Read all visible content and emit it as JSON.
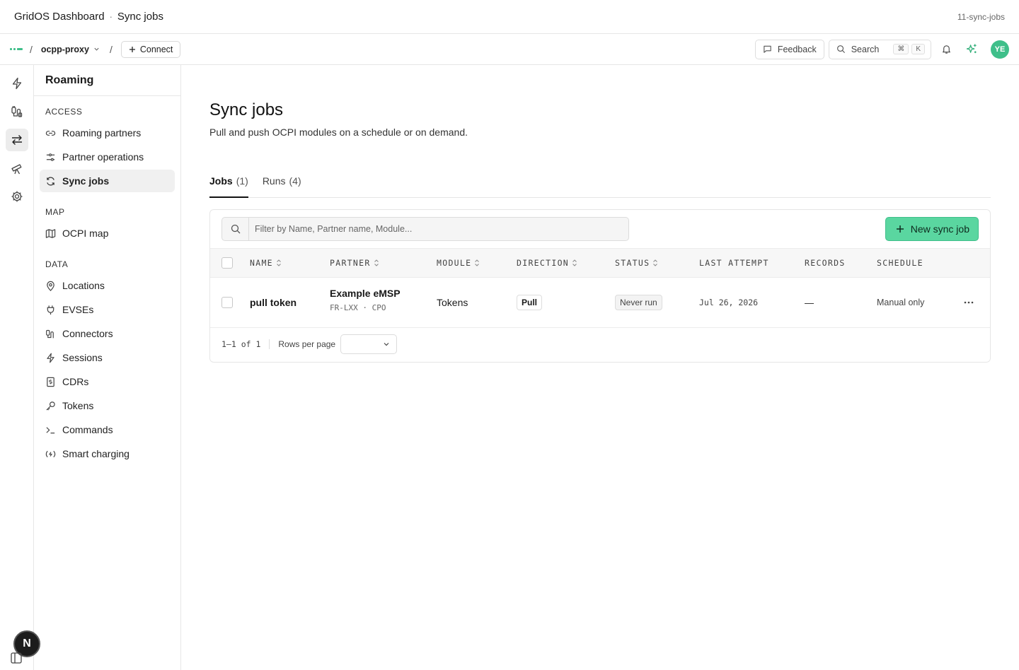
{
  "window": {
    "app_title": "GridOS Dashboard",
    "separator": "·",
    "page": "Sync jobs",
    "tag": "11-sync-jobs"
  },
  "topbar": {
    "slash": "/",
    "project": "ocpp-proxy",
    "connect_label": "Connect",
    "feedback_label": "Feedback",
    "search_label": "Search",
    "kbd": [
      "⌘",
      "K"
    ],
    "avatar_initials": "YE"
  },
  "rail": [
    "bolt-icon",
    "connector-icon",
    "sync-arrows-icon",
    "telescope-icon",
    "gear-icon"
  ],
  "assistant_badge": "N",
  "sidebar": {
    "title": "Roaming",
    "sections": [
      {
        "label": "ACCESS",
        "items": [
          "Roaming partners",
          "Partner operations",
          "Sync jobs"
        ]
      },
      {
        "label": "MAP",
        "items": [
          "OCPI map"
        ]
      },
      {
        "label": "DATA",
        "items": [
          "Locations",
          "EVSEs",
          "Connectors",
          "Sessions",
          "CDRs",
          "Tokens",
          "Commands",
          "Smart charging"
        ]
      }
    ],
    "active": "Sync jobs"
  },
  "main": {
    "title": "Sync jobs",
    "subtitle": "Pull and push OCPI modules on a schedule or on demand.",
    "tabs": [
      {
        "label": "Jobs",
        "count": "(1)"
      },
      {
        "label": "Runs",
        "count": "(4)"
      }
    ],
    "filter_placeholder": "Filter by Name, Partner name, Module...",
    "new_button": "New sync job",
    "columns": [
      "NAME",
      "PARTNER",
      "MODULE",
      "DIRECTION",
      "STATUS",
      "LAST ATTEMPT",
      "RECORDS",
      "SCHEDULE"
    ],
    "rows": [
      {
        "name": "pull token",
        "partner": "Example eMSP",
        "partner_meta": "FR-LXX · CPO",
        "module": "Tokens",
        "direction": "Pull",
        "status": "Never run",
        "last_attempt": "Jul 26, 2026",
        "records": "—",
        "schedule": "Manual only"
      }
    ],
    "pagination": {
      "range": "1–1 of 1",
      "rows_per_page_label": "Rows per page"
    }
  },
  "colors": {
    "accent": "#5ad6a0",
    "accent_border": "#3fbf8a"
  }
}
